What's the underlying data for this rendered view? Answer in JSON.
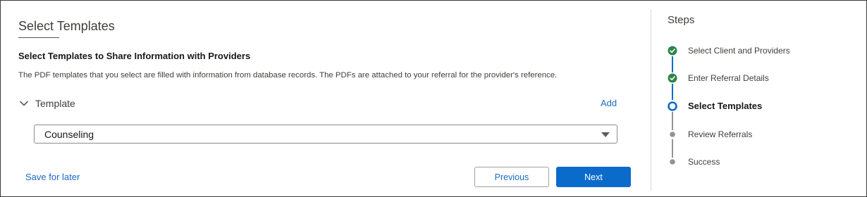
{
  "panel": {
    "title": "Select Templates",
    "heading": "Select Templates to Share Information with Providers",
    "description": "The PDF templates that you select are filled with information from database records. The PDFs are attached to your referral for the provider's reference.",
    "template_section_label": "Template",
    "add_label": "Add",
    "selected_template": "Counseling",
    "save_for_later_label": "Save for later",
    "previous_label": "Previous",
    "next_label": "Next"
  },
  "steps": {
    "title": "Steps",
    "items": [
      {
        "label": "Select Client and Providers",
        "status": "complete"
      },
      {
        "label": "Enter Referral Details",
        "status": "complete"
      },
      {
        "label": "Select Templates",
        "status": "current"
      },
      {
        "label": "Review Referrals",
        "status": "upcoming"
      },
      {
        "label": "Success",
        "status": "upcoming"
      }
    ]
  },
  "colors": {
    "complete": "#2e844a",
    "current": "#0b6bcb",
    "upcoming": "#939393",
    "link": "#1b6ac0",
    "primary_button": "#0b6bcb"
  },
  "icons": {
    "expand": "chevron-down-icon",
    "select": "caret-down-icon",
    "complete_step": "check-circle-icon",
    "current_step": "ring-icon",
    "upcoming_step": "dot-icon"
  }
}
